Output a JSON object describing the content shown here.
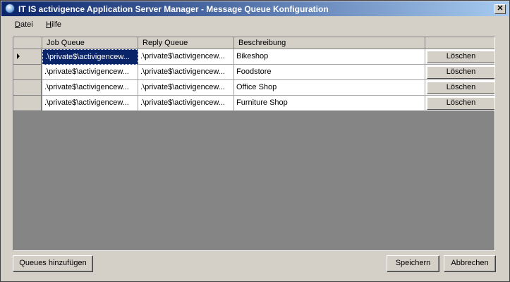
{
  "window": {
    "title": "IT IS activigence Application Server Manager - Message Queue Konfiguration",
    "close_glyph": "✕"
  },
  "menu": [
    {
      "key": "D",
      "rest": "atei"
    },
    {
      "key": "H",
      "rest": "ilfe"
    }
  ],
  "grid": {
    "columns": [
      "Job Queue",
      "Reply Queue",
      "Beschreibung",
      ""
    ],
    "rows": [
      {
        "job_queue": ".\\private$\\activigencew...",
        "reply_queue": ".\\private$\\activigencew...",
        "description": "Bikeshop",
        "delete_label": "Löschen",
        "current": true
      },
      {
        "job_queue": ".\\private$\\activigencew...",
        "reply_queue": ".\\private$\\activigencew...",
        "description": "Foodstore",
        "delete_label": "Löschen"
      },
      {
        "job_queue": ".\\private$\\activigencew...",
        "reply_queue": ".\\private$\\activigencew...",
        "description": "Office Shop",
        "delete_label": "Löschen"
      },
      {
        "job_queue": ".\\private$\\activigencew...",
        "reply_queue": ".\\private$\\activigencew...",
        "description": "Furniture Shop",
        "delete_label": "Löschen"
      }
    ]
  },
  "buttons": {
    "add_queues": "Queues hinzufügen",
    "save": "Speichern",
    "cancel": "Abbrechen"
  },
  "colors": {
    "title_start": "#0a246a",
    "title_end": "#a6caf0",
    "face": "#d4d0c8",
    "grid_bg": "#858585",
    "selection": "#0a246a"
  },
  "icons": {
    "app": "app-globe-icon",
    "close": "close-icon",
    "current_row": "row-pointer-icon"
  }
}
